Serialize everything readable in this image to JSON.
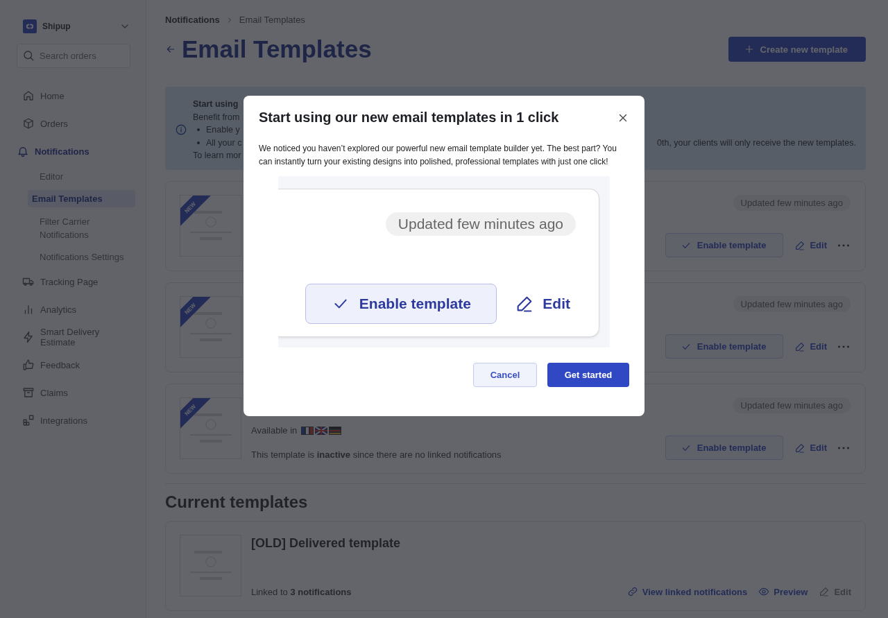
{
  "sidebar": {
    "brand": "Shipup",
    "search": {
      "placeholder": "Search orders"
    },
    "items": [
      {
        "label": "Home",
        "selected": false
      },
      {
        "label": "Orders",
        "selected": false
      },
      {
        "label": "Notifications",
        "selected": true,
        "children": [
          {
            "label": "Editor",
            "selected": false
          },
          {
            "label": "Email Templates",
            "selected": true
          },
          {
            "label": "Filter Carrier Notifications",
            "selected": false
          },
          {
            "label": "Notifications Settings",
            "selected": false
          }
        ]
      },
      {
        "label": "Tracking Page",
        "selected": false
      },
      {
        "label": "Analytics",
        "selected": false
      },
      {
        "label": "Smart Delivery Estimate",
        "selected": false
      },
      {
        "label": "Feedback",
        "selected": false
      },
      {
        "label": "Claims",
        "selected": false
      },
      {
        "label": "Integrations",
        "selected": false
      }
    ]
  },
  "breadcrumb": [
    "Notifications",
    "Email Templates"
  ],
  "page_title": "Email Templates",
  "create_button": "Create new template",
  "banner": {
    "lines": [
      {
        "kind": "heading",
        "text": "Start using"
      },
      {
        "kind": "text",
        "text": "Benefit from"
      },
      {
        "kind": "bullet",
        "text": "Enable y"
      },
      {
        "kind": "bullet",
        "text": "All your c",
        "tail": "0th, your clients will only receive the new templates."
      },
      {
        "kind": "text",
        "text": "To learn mor"
      }
    ]
  },
  "new_templates": [
    {
      "ribbon": "NEW",
      "updated": "Updated few minutes ago",
      "enable_button": "Enable template",
      "edit": "Edit"
    },
    {
      "ribbon": "NEW",
      "updated": "Updated few minutes ago",
      "enable_button": "Enable template",
      "edit": "Edit"
    },
    {
      "ribbon": "NEW",
      "updated": "Updated few minutes ago",
      "enable_button": "Enable template",
      "edit": "Edit",
      "available_in": "Available in",
      "status_text": "This template is **inactive** since there are no linked notifications"
    }
  ],
  "current_section": "Current templates",
  "current_templates": [
    {
      "title": "[OLD] Delivered template",
      "linked": "Linked to **3 notifications**",
      "view_linked": "View linked notifications",
      "preview": "Preview",
      "edit": "Edit",
      "edit_disabled": true
    }
  ],
  "modal": {
    "title": "Start using our new email templates in 1 click",
    "body": "We noticed you haven’t explored our powerful new email template builder yet. The best part? You can instantly turn your existing designs into polished, professional templates with just one click!",
    "illustration": {
      "badge": "Updated few minutes ago",
      "enable_button": "Enable template",
      "edit": "Edit"
    },
    "cancel": "Cancel",
    "confirm": "Get started"
  }
}
